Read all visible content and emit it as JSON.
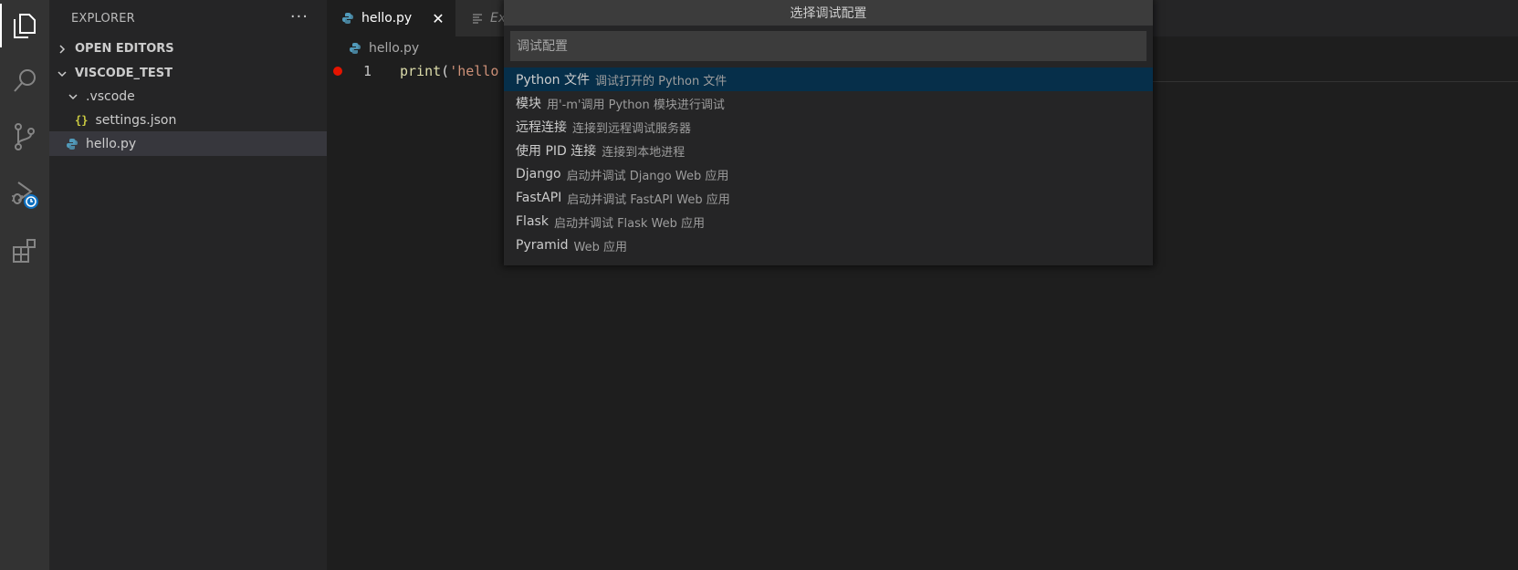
{
  "activity_bar": {
    "icons": [
      "explorer-icon",
      "search-icon",
      "source-control-icon",
      "run-debug-icon",
      "extensions-icon"
    ]
  },
  "sidebar": {
    "title": "EXPLORER",
    "more_label": "···",
    "open_editors": "OPEN EDITORS",
    "workspace": "VISCODE_TEST",
    "folder": ".vscode",
    "settings_file": "settings.json",
    "json_icon_label": "{}",
    "active_file": "hello.py"
  },
  "editor": {
    "tabs": [
      {
        "label": "hello.py",
        "close": "✕"
      },
      {
        "label": "Ex"
      }
    ],
    "breadcrumb": "hello.py",
    "line_number": "1",
    "code_fn": "print",
    "code_paren": "(",
    "code_str": "'hello"
  },
  "quick_pick": {
    "title": "选择调试配置",
    "placeholder": "调试配置",
    "items": [
      {
        "label": "Python 文件",
        "desc": "调试打开的 Python 文件"
      },
      {
        "label": "模块",
        "desc": "用'-m'调用 Python 模块进行调试"
      },
      {
        "label": "远程连接",
        "desc": "连接到远程调试服务器"
      },
      {
        "label": "使用 PID 连接",
        "desc": "连接到本地进程"
      },
      {
        "label": "Django",
        "desc": "启动并调试 Django Web 应用"
      },
      {
        "label": "FastAPI",
        "desc": "启动并调试 FastAPI Web 应用"
      },
      {
        "label": "Flask",
        "desc": "启动并调试 Flask Web 应用"
      },
      {
        "label": "Pyramid",
        "desc": "Web 应用"
      }
    ]
  },
  "colors": {
    "activity_bar": "#333333",
    "sidebar": "#252526",
    "editor": "#1e1e1e",
    "quick_pick_focus": "#062f4a",
    "breakpoint": "#e51400"
  }
}
